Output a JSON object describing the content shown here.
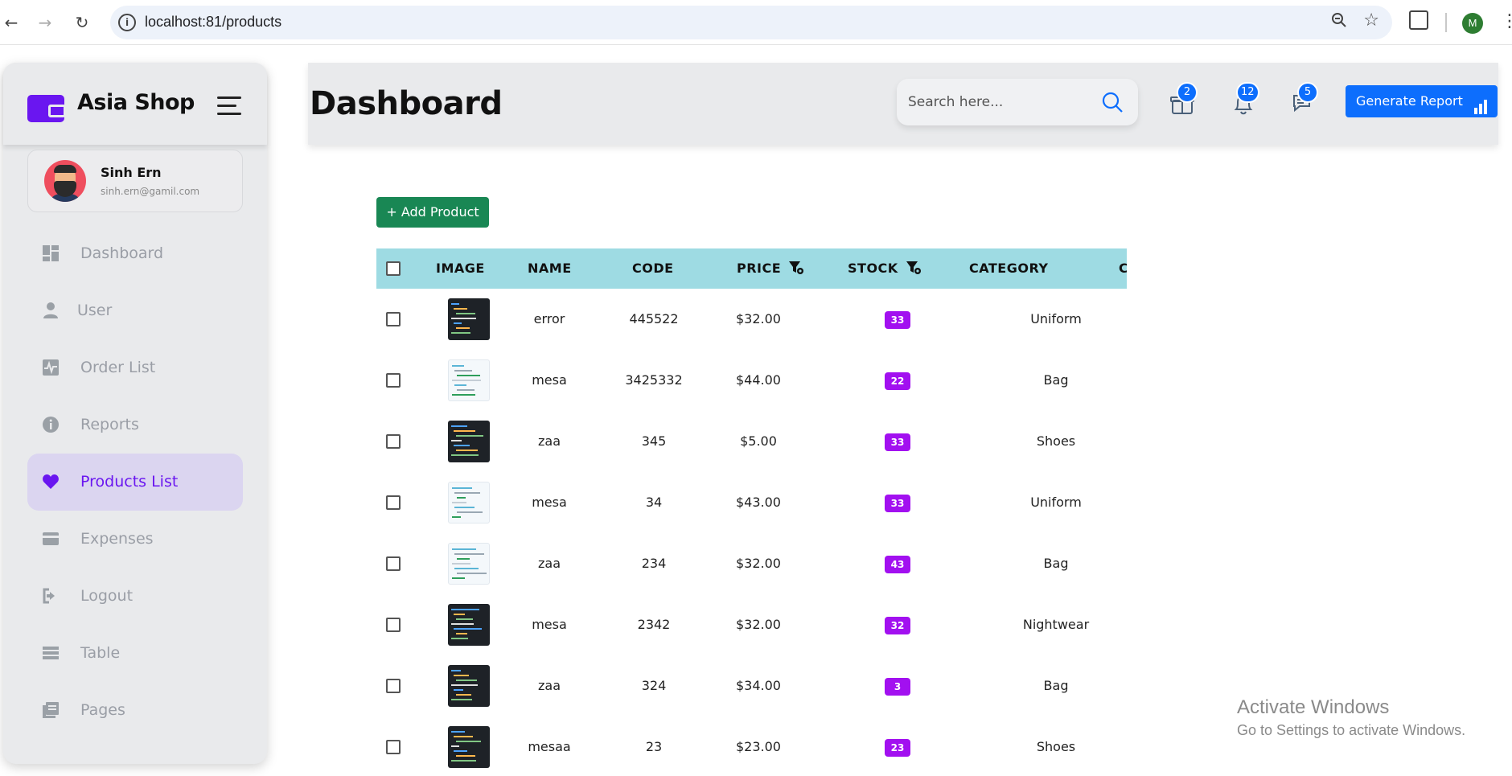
{
  "browser": {
    "url": "localhost:81/products",
    "profile_initial": "M"
  },
  "sidebar": {
    "brand": "Asia Shop",
    "user": {
      "name": "Sinh Ern",
      "email": "sinh.ern@gamil.com"
    },
    "items": [
      {
        "label": "Dashboard",
        "icon": "dashboard-icon",
        "active": false
      },
      {
        "label": "User",
        "icon": "user-icon",
        "active": false
      },
      {
        "label": "Order List",
        "icon": "pulse-icon",
        "active": false
      },
      {
        "label": "Reports",
        "icon": "info-icon",
        "active": false
      },
      {
        "label": "Products List",
        "icon": "heart-icon",
        "active": true
      },
      {
        "label": "Expenses",
        "icon": "wallet-icon",
        "active": false
      },
      {
        "label": "Logout",
        "icon": "logout-icon",
        "active": false
      },
      {
        "label": "Table",
        "icon": "table-icon",
        "active": false
      },
      {
        "label": "Pages",
        "icon": "pages-icon",
        "active": false
      }
    ],
    "accent": "#6a16f0"
  },
  "topbar": {
    "title": "Dashboard",
    "search_placeholder": "Search here...",
    "badges": {
      "gift": "2",
      "notifications": "12",
      "messages": "5"
    },
    "report_button": "Generate Report"
  },
  "products": {
    "add_button": "+ Add Product",
    "columns": [
      "IMAGE",
      "NAME",
      "CODE",
      "PRICE",
      "STOCK",
      "CATEGORY",
      "C"
    ],
    "rows": [
      {
        "thumb": "dark",
        "name": "error",
        "code": "445522",
        "price": "$32.00",
        "stock": "33",
        "category": "Uniform"
      },
      {
        "thumb": "light",
        "name": "mesa",
        "code": "3425332",
        "price": "$44.00",
        "stock": "22",
        "category": "Bag"
      },
      {
        "thumb": "dark",
        "name": "zaa",
        "code": "345",
        "price": "$5.00",
        "stock": "33",
        "category": "Shoes"
      },
      {
        "thumb": "light",
        "name": "mesa",
        "code": "34",
        "price": "$43.00",
        "stock": "33",
        "category": "Uniform"
      },
      {
        "thumb": "light",
        "name": "zaa",
        "code": "234",
        "price": "$32.00",
        "stock": "43",
        "category": "Bag"
      },
      {
        "thumb": "dark",
        "name": "mesa",
        "code": "2342",
        "price": "$32.00",
        "stock": "32",
        "category": "Nightwear"
      },
      {
        "thumb": "dark",
        "name": "zaa",
        "code": "324",
        "price": "$34.00",
        "stock": "3",
        "category": "Bag"
      },
      {
        "thumb": "dark",
        "name": "mesaa",
        "code": "23",
        "price": "$23.00",
        "stock": "23",
        "category": "Shoes"
      }
    ],
    "header_color": "#9edbe3",
    "stock_badge_color": "#a210f0"
  },
  "watermark": {
    "title": "Activate Windows",
    "subtitle": "Go to Settings to activate Windows."
  }
}
